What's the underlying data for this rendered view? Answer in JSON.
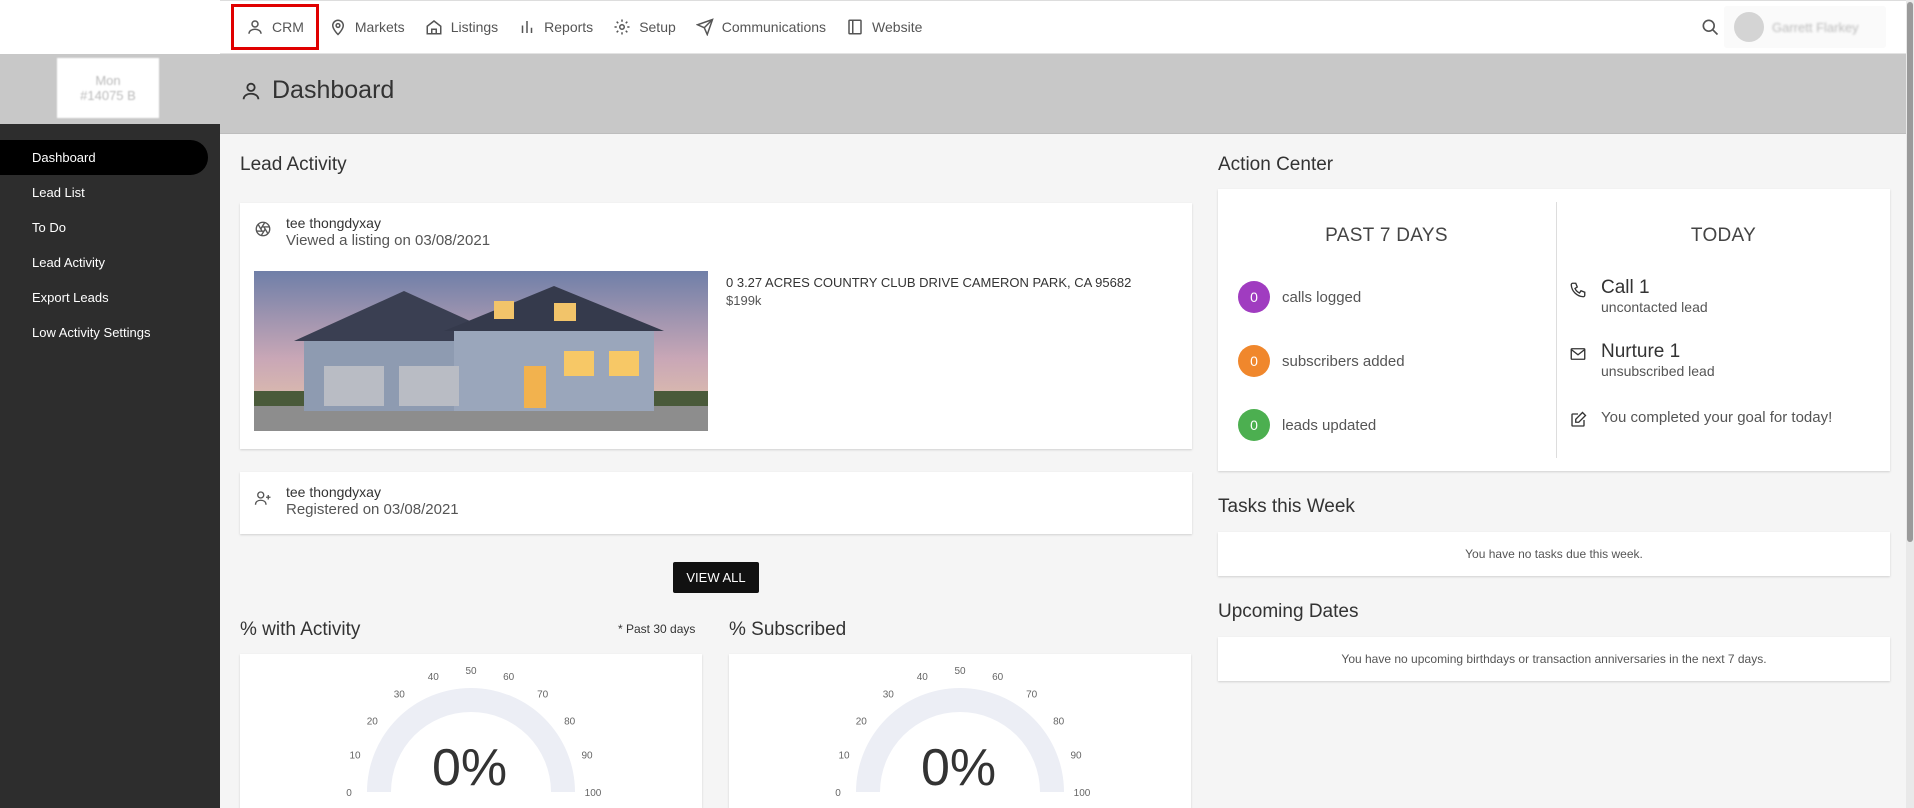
{
  "nav": {
    "items": [
      {
        "label": "CRM",
        "icon": "person-icon",
        "active": true
      },
      {
        "label": "Markets",
        "icon": "map-pin-icon"
      },
      {
        "label": "Listings",
        "icon": "home-icon"
      },
      {
        "label": "Reports",
        "icon": "bar-chart-icon"
      },
      {
        "label": "Setup",
        "icon": "gear-icon"
      },
      {
        "label": "Communications",
        "icon": "send-icon"
      },
      {
        "label": "Website",
        "icon": "layout-icon"
      }
    ],
    "user_name": "Garrett Flarkey"
  },
  "brand": {
    "line1": "Mon",
    "line2": "#14075 B"
  },
  "sidebar": {
    "items": [
      {
        "label": "Dashboard",
        "active": true
      },
      {
        "label": "Lead List"
      },
      {
        "label": "To Do"
      },
      {
        "label": "Lead Activity"
      },
      {
        "label": "Export Leads"
      },
      {
        "label": "Low Activity Settings"
      }
    ]
  },
  "page": {
    "title": "Dashboard"
  },
  "lead_activity": {
    "title": "Lead Activity",
    "items": [
      {
        "name": "tee thongdyxay",
        "desc": "Viewed a listing on 03/08/2021",
        "listing_address": "0 3.27 ACRES COUNTRY CLUB DRIVE CAMERON PARK, CA 95682",
        "listing_price": "$199k"
      },
      {
        "name": "tee thongdyxay",
        "desc": "Registered on 03/08/2021"
      }
    ],
    "view_all": "VIEW ALL"
  },
  "gauges": {
    "activity": {
      "title": "% with Activity",
      "note": "* Past 30 days",
      "value": "0%",
      "percent": 0
    },
    "subscribed": {
      "title": "% Subscribed",
      "value": "0%",
      "percent": 0
    },
    "ticks": [
      "0",
      "10",
      "20",
      "30",
      "40",
      "50",
      "60",
      "70",
      "80",
      "90",
      "100"
    ]
  },
  "action_center": {
    "title": "Action Center",
    "past": {
      "heading": "PAST 7 DAYS",
      "stats": [
        {
          "value": "0",
          "label": "calls logged",
          "color": "#a03cc0"
        },
        {
          "value": "0",
          "label": "subscribers added",
          "color": "#f0872c"
        },
        {
          "value": "0",
          "label": "leads updated",
          "color": "#4caf50"
        }
      ]
    },
    "today": {
      "heading": "TODAY",
      "call_main": "Call 1",
      "call_sub": "uncontacted lead",
      "nurture_main": "Nurture 1",
      "nurture_sub": "unsubscribed lead",
      "goal": "You completed your goal for today!"
    }
  },
  "tasks": {
    "title": "Tasks this Week",
    "empty": "You have no tasks due this week."
  },
  "dates": {
    "title": "Upcoming Dates",
    "empty": "You have no upcoming birthdays or transaction anniversaries in the next 7 days."
  }
}
